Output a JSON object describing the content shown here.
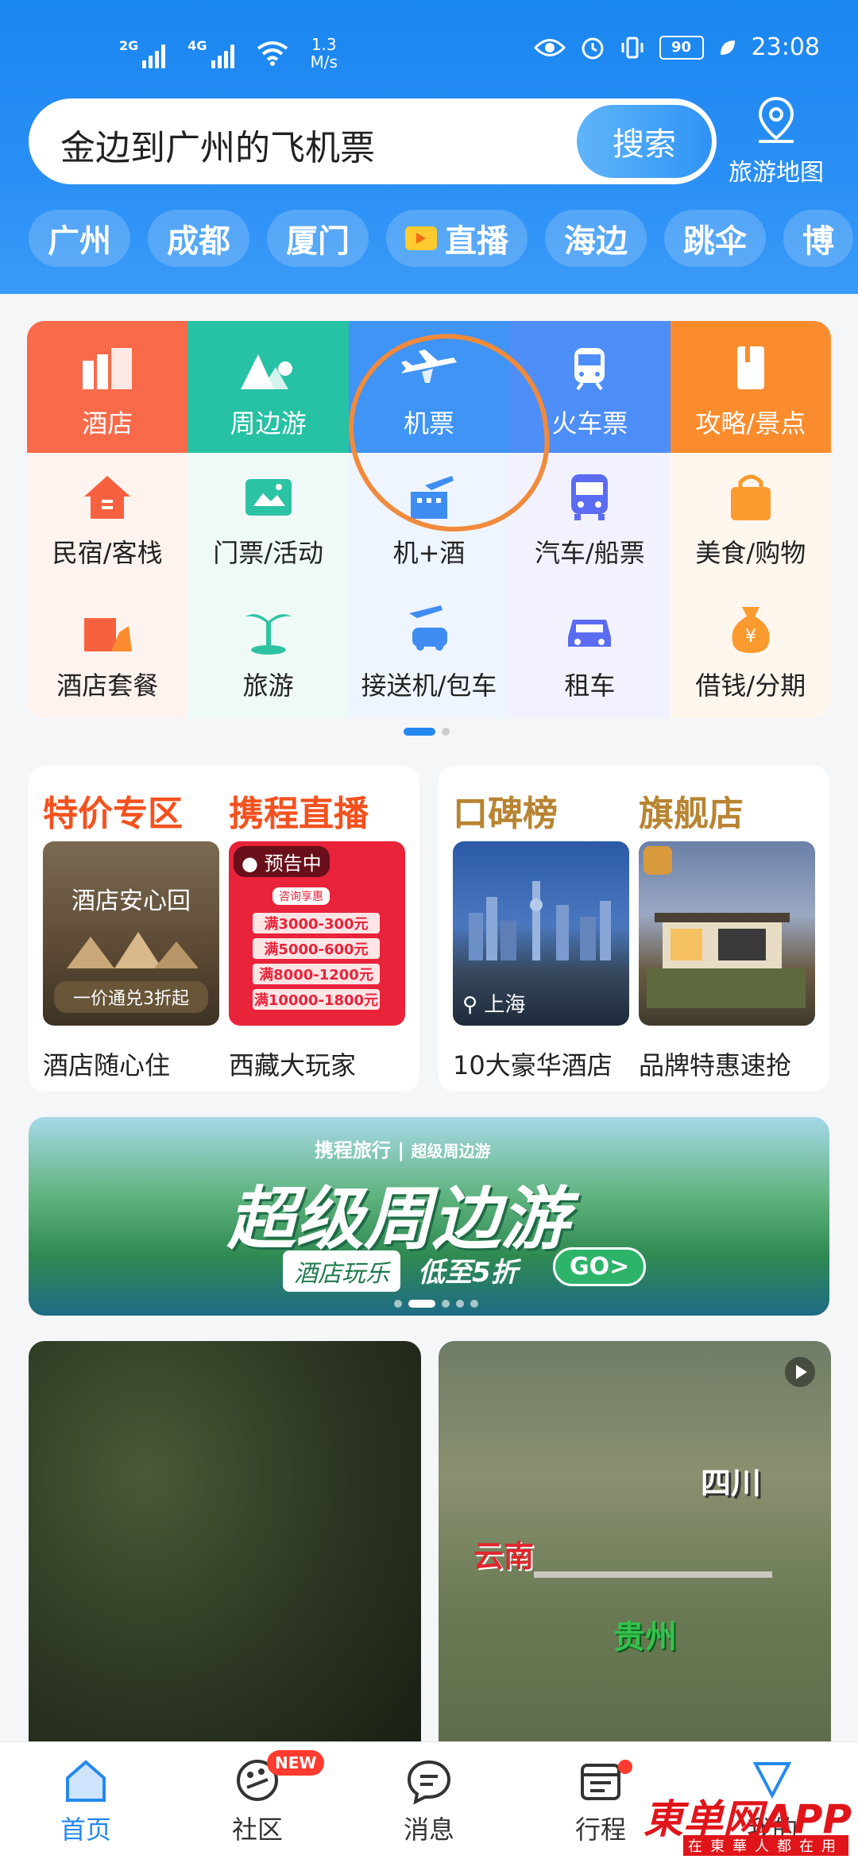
{
  "status": {
    "net1": "2G",
    "net2": "4G",
    "speed_value": "1.3",
    "speed_unit": "M/s",
    "battery": "90",
    "time": "23:08"
  },
  "search": {
    "query": "金边到广州的飞机票",
    "button": "搜索"
  },
  "map": {
    "label": "旅游地图"
  },
  "chips": [
    "广州",
    "成都",
    "厦门",
    "直播",
    "海边",
    "跳伞",
    "博"
  ],
  "grid_top": [
    {
      "label": "酒店",
      "color": "#f96a4a"
    },
    {
      "label": "周边游",
      "color": "#27c1a4"
    },
    {
      "label": "机票",
      "color": "#3f94f5"
    },
    {
      "label": "火车票",
      "color": "#4d8ef8"
    },
    {
      "label": "攻略/景点",
      "color": "#fb8c2e"
    }
  ],
  "grid_row2": [
    "民宿/客栈",
    "门票/活动",
    "机+酒",
    "汽车/船票",
    "美食/购物"
  ],
  "grid_row3": [
    "酒店套餐",
    "旅游",
    "接送机/包车",
    "租车",
    "借钱/分期"
  ],
  "promo": {
    "left": {
      "h1": "特价专区",
      "h2": "携程直播",
      "t1_text": "酒店安心回",
      "t1_sub": "一价通兑3折起",
      "t2_tag": "预告中",
      "t2_coupon": "咨询享惠",
      "t2_lines": [
        "满3000-300元",
        "满5000-600元",
        "满8000-1200元",
        "满10000-1800元"
      ],
      "c1": "酒店随心住",
      "c2": "西藏大玩家"
    },
    "right": {
      "h1": "口碑榜",
      "h2": "旗舰店",
      "loc": "上海",
      "c1": "10大豪华酒店",
      "c2": "品牌特惠速抢"
    }
  },
  "banner": {
    "brand": "携程旅行",
    "sub": "超级周边游",
    "title": "超级周边游",
    "pill": "酒店玩乐",
    "discount": "低至5折",
    "go": "GO>"
  },
  "feed": {
    "labels": [
      "四川",
      "云南",
      "贵州"
    ]
  },
  "tabs": [
    {
      "label": "首页"
    },
    {
      "label": "社区",
      "badge": "NEW"
    },
    {
      "label": "消息"
    },
    {
      "label": "行程"
    },
    {
      "label": "我的"
    }
  ],
  "watermark": {
    "main": "東单网APP",
    "sub": "在東華人都在用"
  }
}
